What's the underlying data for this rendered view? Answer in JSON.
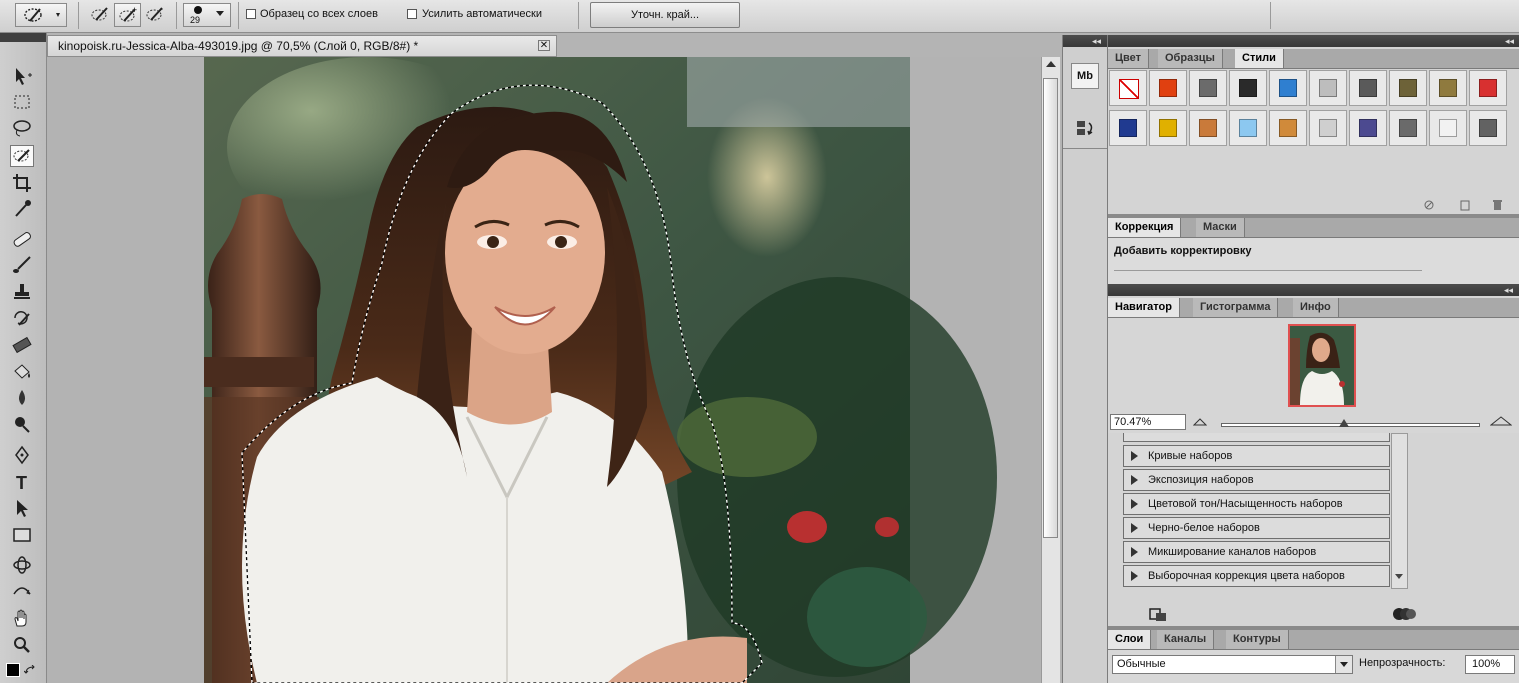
{
  "options_bar": {
    "brush_size": "29",
    "sample_all_layers_label": "Образец со всех слоев",
    "auto_enhance_label": "Усилить автоматически",
    "refine_edge_label": "Уточн. край..."
  },
  "document": {
    "tab_title": "kinopoisk.ru-Jessica-Alba-493019.jpg @ 70,5% (Слой 0, RGB/8#) *",
    "close_glyph": "✕"
  },
  "dock": {
    "collapse_glyph": "◂◂",
    "mb_label": "Mb"
  },
  "styles_panel": {
    "tabs": [
      "Цвет",
      "Образцы",
      "Стили"
    ],
    "active_tab": 2,
    "swatch_colors": [
      [
        "#ffffff",
        "#e04010",
        "#6b6b6b",
        "#2a2a2a",
        "#2f7fd0",
        "#bdbdbd",
        "#5a5a5a",
        "#6d6238",
        "#8f7a3e",
        "#d83030"
      ],
      [
        "#203a90",
        "#e0b000",
        "#c97a3a",
        "#8cc8f0",
        "#d08a3a",
        "#cfcfcf",
        "#4c4a90",
        "#6a6a6a",
        "#f2f2f2",
        "#626262"
      ]
    ]
  },
  "adjustments_panel": {
    "tabs": [
      "Коррекция",
      "Маски"
    ],
    "active_tab": 0,
    "heading": "Добавить корректировку",
    "presets": [
      "Кривые наборов",
      "Экспозиция наборов",
      "Цветовой тон/Насыщенность наборов",
      "Черно-белое наборов",
      "Микширование каналов наборов",
      "Выборочная коррекция цвета наборов"
    ]
  },
  "navigator_panel": {
    "tabs": [
      "Навигатор",
      "Гистограмма",
      "Инфо"
    ],
    "active_tab": 0,
    "zoom_value": "70.47%",
    "frame_color": "#e05050"
  },
  "layers_panel": {
    "tabs": [
      "Слои",
      "Каналы",
      "Контуры"
    ],
    "active_tab": 0,
    "blend_mode": "Обычные",
    "opacity_label": "Непрозрачность:",
    "opacity_value": "100%"
  }
}
